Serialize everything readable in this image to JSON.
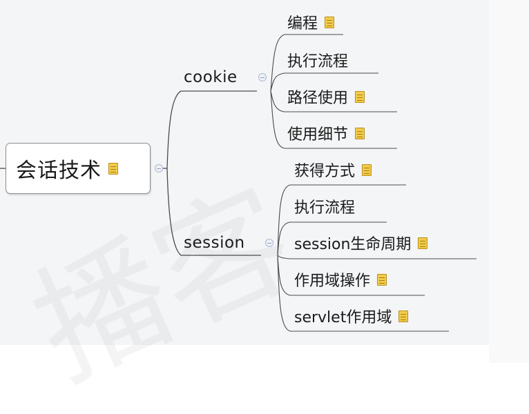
{
  "root": {
    "label": "会话技术"
  },
  "branches": {
    "cookie": {
      "label": "cookie",
      "children": [
        "编程",
        "执行流程",
        "路径使用",
        "使用细节"
      ]
    },
    "session": {
      "label": "session",
      "children": [
        "获得方式",
        "执行流程",
        "session生命周期",
        "作用域操作",
        "servlet作用域"
      ]
    }
  },
  "colors": {
    "canvas": "#f4f5f7",
    "line": "#4a4a4a",
    "note_icon": "#f2cc4a"
  },
  "icons": {
    "note": "note-icon",
    "collapse": "collapse-toggle-icon"
  }
}
